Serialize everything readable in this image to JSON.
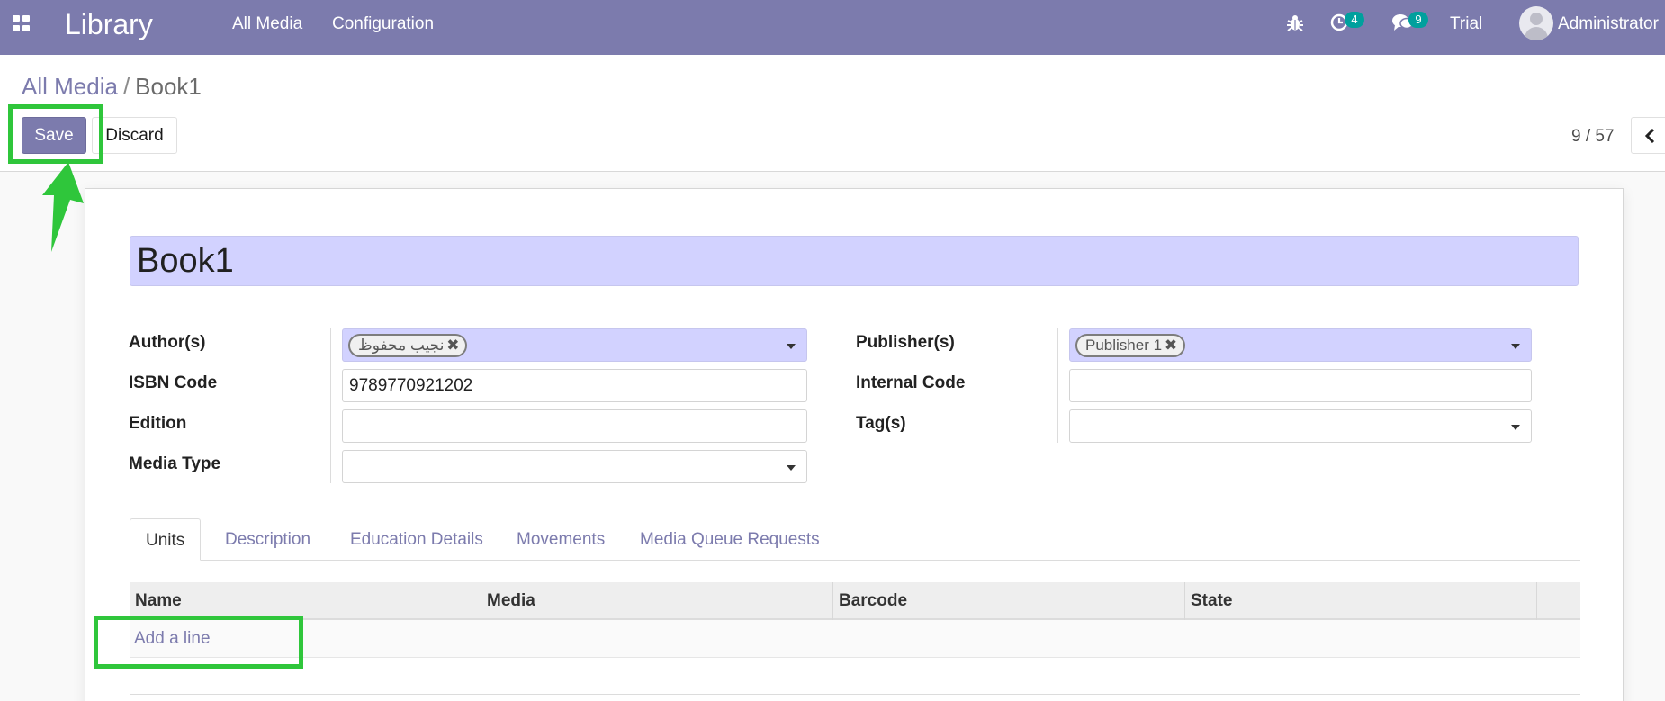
{
  "navbar": {
    "brand": "Library",
    "menus": [
      "All Media",
      "Configuration"
    ],
    "activity_count": "4",
    "message_count": "9",
    "trial": "Trial",
    "user": "Administrator"
  },
  "breadcrumb": {
    "parent": "All Media",
    "separator": "/",
    "current": "Book1"
  },
  "buttons": {
    "save": "Save",
    "discard": "Discard"
  },
  "pager": {
    "value": "9 / 57"
  },
  "form": {
    "name": "Book1",
    "left_fields": {
      "authors_label": "Author(s)",
      "authors_tags": [
        "نجيب محفوظ"
      ],
      "isbn_label": "ISBN Code",
      "isbn_value": "9789770921202",
      "edition_label": "Edition",
      "edition_value": "",
      "media_type_label": "Media Type",
      "media_type_value": ""
    },
    "right_fields": {
      "publishers_label": "Publisher(s)",
      "publishers_tags": [
        "Publisher 1"
      ],
      "internal_code_label": "Internal Code",
      "internal_code_value": "",
      "tags_label": "Tag(s)",
      "tags_value": ""
    }
  },
  "tabs": [
    "Units",
    "Description",
    "Education Details",
    "Movements",
    "Media Queue Requests"
  ],
  "active_tab": "Units",
  "units_table": {
    "columns": [
      "Name",
      "Media",
      "Barcode",
      "State"
    ],
    "add_line": "Add a line"
  },
  "colors": {
    "brand": "#7c7bad",
    "required_field": "#d2d2ff",
    "badge": "#00a09d",
    "highlight": "#2fc63b"
  }
}
